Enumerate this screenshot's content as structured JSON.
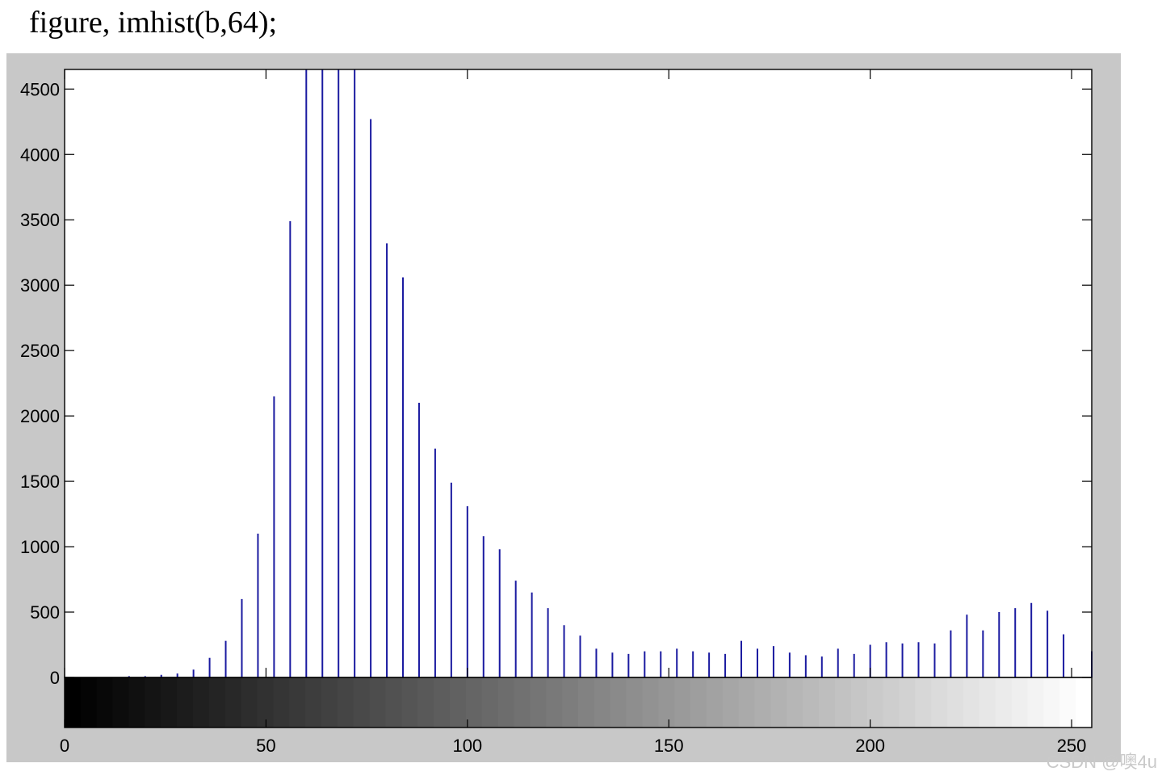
{
  "caption": "figure, imhist(b,64);",
  "watermark": "CSDN @噢4u",
  "colors": {
    "stem": "#1a1aa0",
    "figure_bg": "#c8c8c8",
    "axes_bg": "#ffffff"
  },
  "chart_data": {
    "type": "bar",
    "subtype": "stem-histogram",
    "title": "",
    "xlabel": "",
    "ylabel": "",
    "xlim": [
      0,
      255
    ],
    "ylim": [
      0,
      4650
    ],
    "clipped_at_top": true,
    "grid": false,
    "colorbar": "grayscale gradient 0 (black) to 255 (white) below x-axis",
    "x_ticks": [
      0,
      50,
      100,
      150,
      200,
      250
    ],
    "y_ticks": [
      0,
      500,
      1000,
      1500,
      2000,
      2500,
      3000,
      3500,
      4000,
      4500
    ],
    "x": [
      0,
      4,
      8,
      12,
      16,
      20,
      24,
      28,
      32,
      36,
      40,
      44,
      48,
      52,
      56,
      60,
      64,
      68,
      72,
      76,
      80,
      84,
      88,
      92,
      96,
      100,
      104,
      108,
      112,
      116,
      120,
      124,
      128,
      132,
      136,
      140,
      144,
      148,
      152,
      156,
      160,
      164,
      168,
      172,
      176,
      180,
      184,
      188,
      192,
      196,
      200,
      204,
      208,
      212,
      216,
      220,
      224,
      228,
      232,
      236,
      240,
      244,
      248,
      255
    ],
    "values": [
      0,
      0,
      0,
      0,
      10,
      10,
      20,
      30,
      60,
      150,
      280,
      600,
      1100,
      2150,
      3490,
      4650,
      4650,
      4650,
      4650,
      4270,
      3320,
      3060,
      2100,
      1750,
      1490,
      1310,
      1080,
      980,
      740,
      650,
      530,
      400,
      320,
      220,
      190,
      180,
      200,
      200,
      220,
      200,
      190,
      180,
      280,
      220,
      240,
      190,
      170,
      160,
      220,
      180,
      250,
      270,
      260,
      270,
      260,
      360,
      480,
      360,
      500,
      530,
      570,
      510,
      330,
      200
    ]
  }
}
